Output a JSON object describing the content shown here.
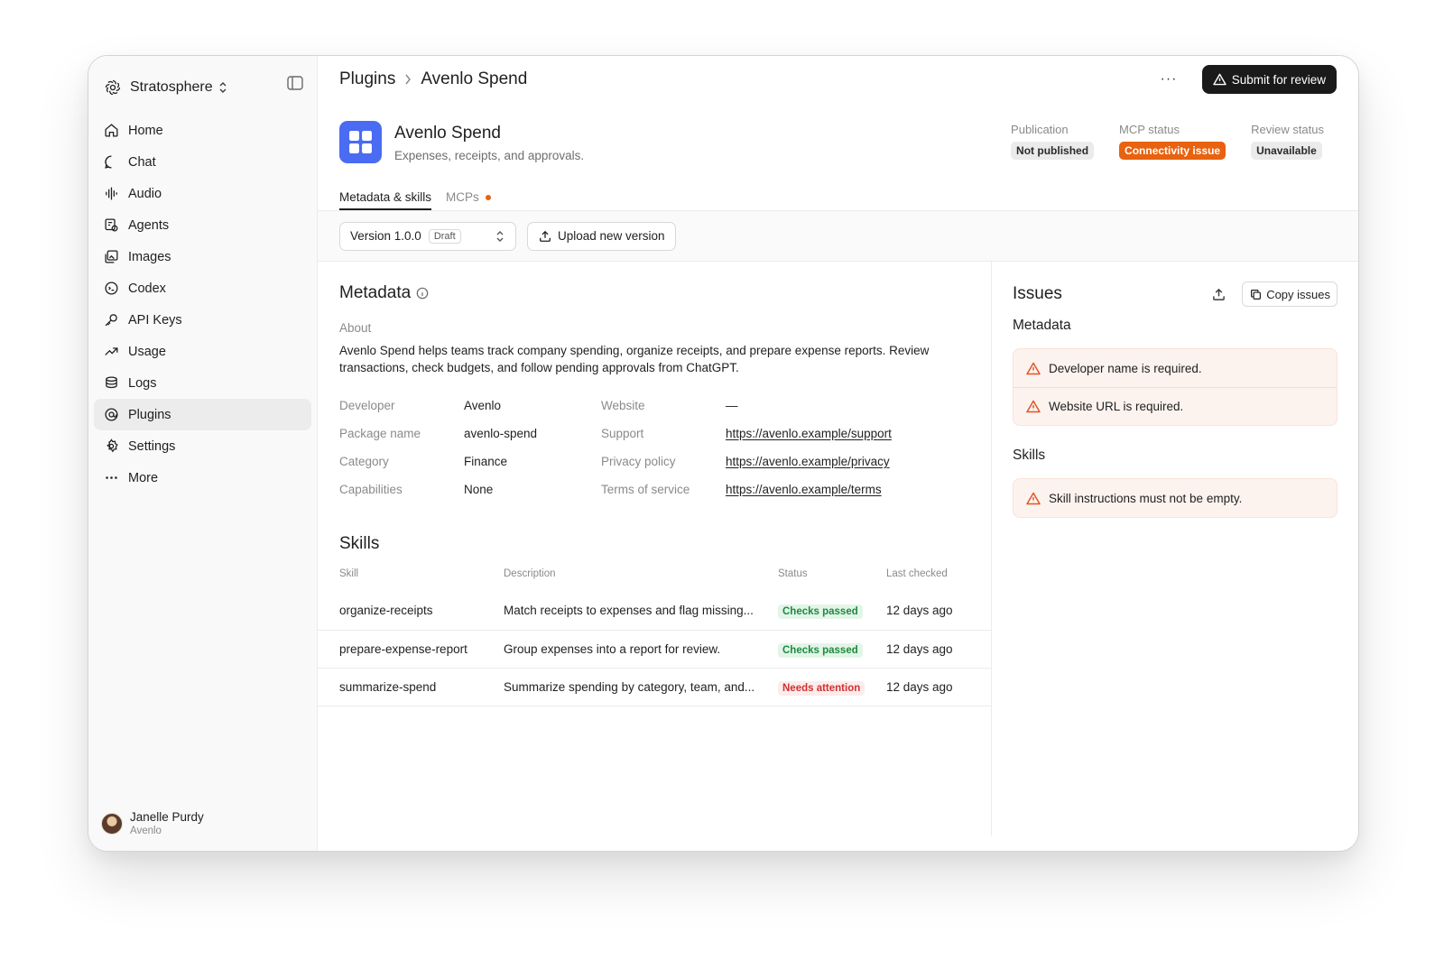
{
  "workspace": {
    "name": "Stratosphere"
  },
  "sidebar": {
    "items": [
      {
        "label": "Home",
        "icon": "home-icon"
      },
      {
        "label": "Chat",
        "icon": "chat-icon"
      },
      {
        "label": "Audio",
        "icon": "audio-icon"
      },
      {
        "label": "Agents",
        "icon": "agents-icon"
      },
      {
        "label": "Images",
        "icon": "images-icon"
      },
      {
        "label": "Codex",
        "icon": "codex-icon"
      },
      {
        "label": "API Keys",
        "icon": "key-icon"
      },
      {
        "label": "Usage",
        "icon": "usage-icon"
      },
      {
        "label": "Logs",
        "icon": "logs-icon"
      },
      {
        "label": "Plugins",
        "icon": "plugins-icon",
        "active": true
      },
      {
        "label": "Settings",
        "icon": "gear-icon"
      },
      {
        "label": "More",
        "icon": "more-icon"
      }
    ]
  },
  "user": {
    "name": "Janelle Purdy",
    "org": "Avenlo"
  },
  "breadcrumb": {
    "parent": "Plugins",
    "current": "Avenlo Spend"
  },
  "toolbar": {
    "more_label": "···",
    "submit_label": "Submit for review"
  },
  "plugin": {
    "name": "Avenlo Spend",
    "description": "Expenses, receipts, and approvals.",
    "brand_color": "#4a6cf2"
  },
  "statuses": {
    "publication": {
      "label": "Publication",
      "value": "Not published"
    },
    "mcp": {
      "label": "MCP status",
      "value": "Connectivity issue",
      "color": "#e8620f"
    },
    "review": {
      "label": "Review status",
      "value": "Unavailable"
    }
  },
  "tabs": [
    {
      "label": "Metadata & skills",
      "active": true
    },
    {
      "label": "MCPs",
      "active": false,
      "indicator": true
    }
  ],
  "version": {
    "label": "Version 1.0.0",
    "tag": "Draft",
    "upload_label": "Upload new version"
  },
  "metadata": {
    "title": "Metadata",
    "about_label": "About",
    "about_text": "Avenlo Spend helps teams track company spending, organize receipts, and prepare expense reports. Review transactions, check budgets, and follow pending approvals from ChatGPT.",
    "fields": {
      "developer": {
        "label": "Developer",
        "value": "Avenlo"
      },
      "package": {
        "label": "Package name",
        "value": "avenlo-spend"
      },
      "category": {
        "label": "Category",
        "value": "Finance"
      },
      "capabilities": {
        "label": "Capabilities",
        "value": "None"
      },
      "website": {
        "label": "Website",
        "value": "—"
      },
      "support": {
        "label": "Support",
        "value": "https://avenlo.example/support"
      },
      "privacy": {
        "label": "Privacy policy",
        "value": "https://avenlo.example/privacy"
      },
      "terms": {
        "label": "Terms of service",
        "value": "https://avenlo.example/terms"
      }
    }
  },
  "skills": {
    "title": "Skills",
    "columns": [
      "Skill",
      "Description",
      "Status",
      "Last checked"
    ],
    "rows": [
      {
        "skill": "organize-receipts",
        "description": "Match receipts to expenses and flag missing...",
        "status": "Checks passed",
        "last_checked": "12 days ago"
      },
      {
        "skill": "prepare-expense-report",
        "description": "Group expenses into a report for review.",
        "status": "Checks passed",
        "last_checked": "12 days ago"
      },
      {
        "skill": "summarize-spend",
        "description": "Summarize spending by category, team, and...",
        "status": "Needs attention",
        "last_checked": "12 days ago"
      }
    ]
  },
  "issues": {
    "title": "Issues",
    "copy_label": "Copy issues",
    "metadata_heading": "Metadata",
    "metadata_items": [
      "Developer name is required.",
      "Website URL is required."
    ],
    "skills_heading": "Skills",
    "skills_items": [
      "Skill instructions must not be empty."
    ]
  }
}
